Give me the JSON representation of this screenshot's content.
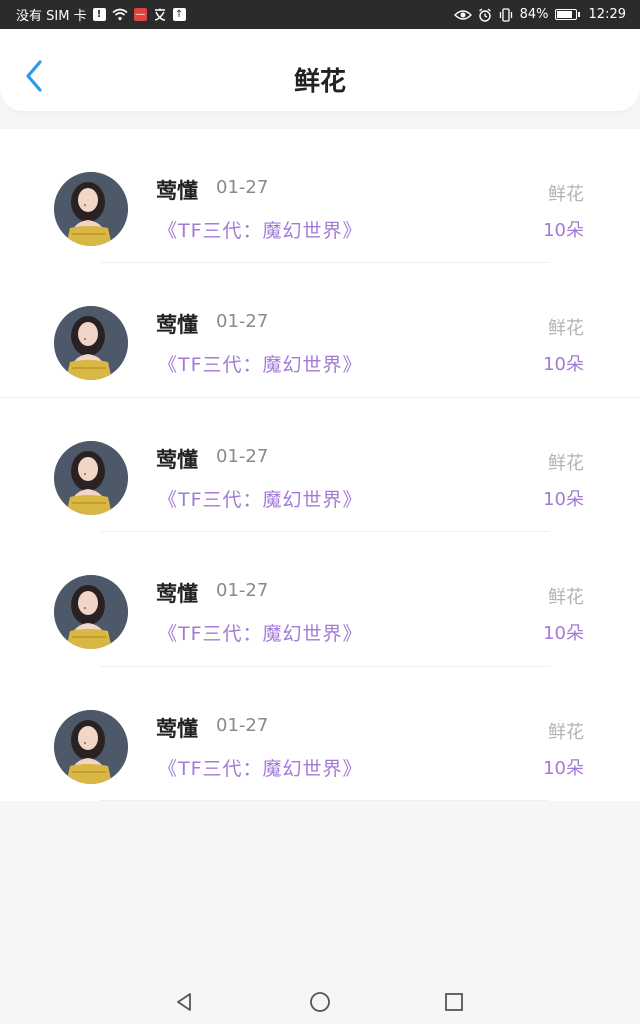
{
  "status_bar": {
    "carrier": "没有 SIM 卡",
    "battery": "84%",
    "time": "12:29"
  },
  "header": {
    "title": "鲜花",
    "back_icon": "chevron-left-icon"
  },
  "items": [
    {
      "name": "莺懂",
      "date": "01-27",
      "title": "《TF三代：魔幻世界》",
      "gift_label": "鲜花",
      "gift_count": "10朵"
    },
    {
      "name": "莺懂",
      "date": "01-27",
      "title": "《TF三代：魔幻世界》",
      "gift_label": "鲜花",
      "gift_count": "10朵"
    },
    {
      "name": "莺懂",
      "date": "01-27",
      "title": "《TF三代：魔幻世界》",
      "gift_label": "鲜花",
      "gift_count": "10朵"
    },
    {
      "name": "莺懂",
      "date": "01-27",
      "title": "《TF三代：魔幻世界》",
      "gift_label": "鲜花",
      "gift_count": "10朵"
    },
    {
      "name": "莺懂",
      "date": "01-27",
      "title": "《TF三代：魔幻世界》",
      "gift_label": "鲜花",
      "gift_count": "10朵"
    }
  ],
  "colors": {
    "accent_purple": "#a37bd6",
    "back_blue": "#2e9be8",
    "status_bar": "#2b2b2b"
  },
  "nav_bar": {
    "back": "triangle-back-icon",
    "home": "circle-home-icon",
    "recents": "square-recents-icon"
  }
}
